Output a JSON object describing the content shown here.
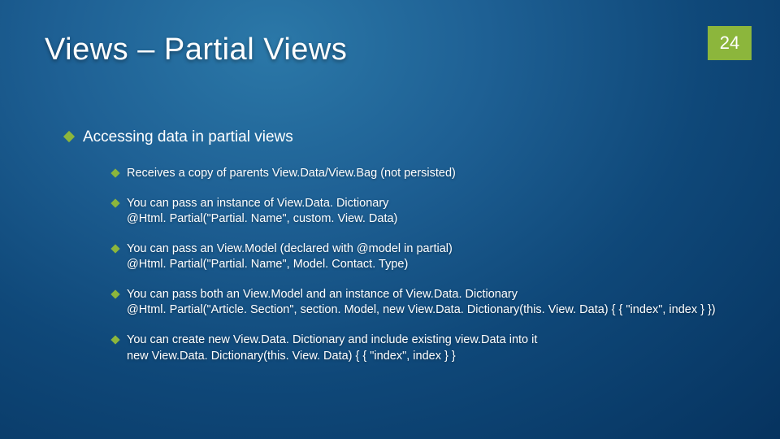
{
  "header": {
    "title": "Views – Partial Views",
    "page_number": "24"
  },
  "main": {
    "heading": "Accessing data in partial views",
    "bullets": [
      "Receives a copy of parents View.Data/View.Bag (not persisted)",
      "You can pass an instance of View.Data. Dictionary\n@Html. Partial(\"Partial. Name\", custom. View. Data)",
      "You can pass an View.Model (declared with @model in partial)\n@Html. Partial(\"Partial. Name\", Model. Contact. Type)",
      "You can pass both an View.Model and an instance of View.Data. Dictionary\n@Html. Partial(\"Article. Section\", section. Model, new View.Data. Dictionary(this. View. Data) { { \"index\", index } })",
      "You can create new View.Data. Dictionary and include existing view.Data into it\nnew View.Data. Dictionary(this. View. Data) { { \"index\", index } }"
    ]
  }
}
